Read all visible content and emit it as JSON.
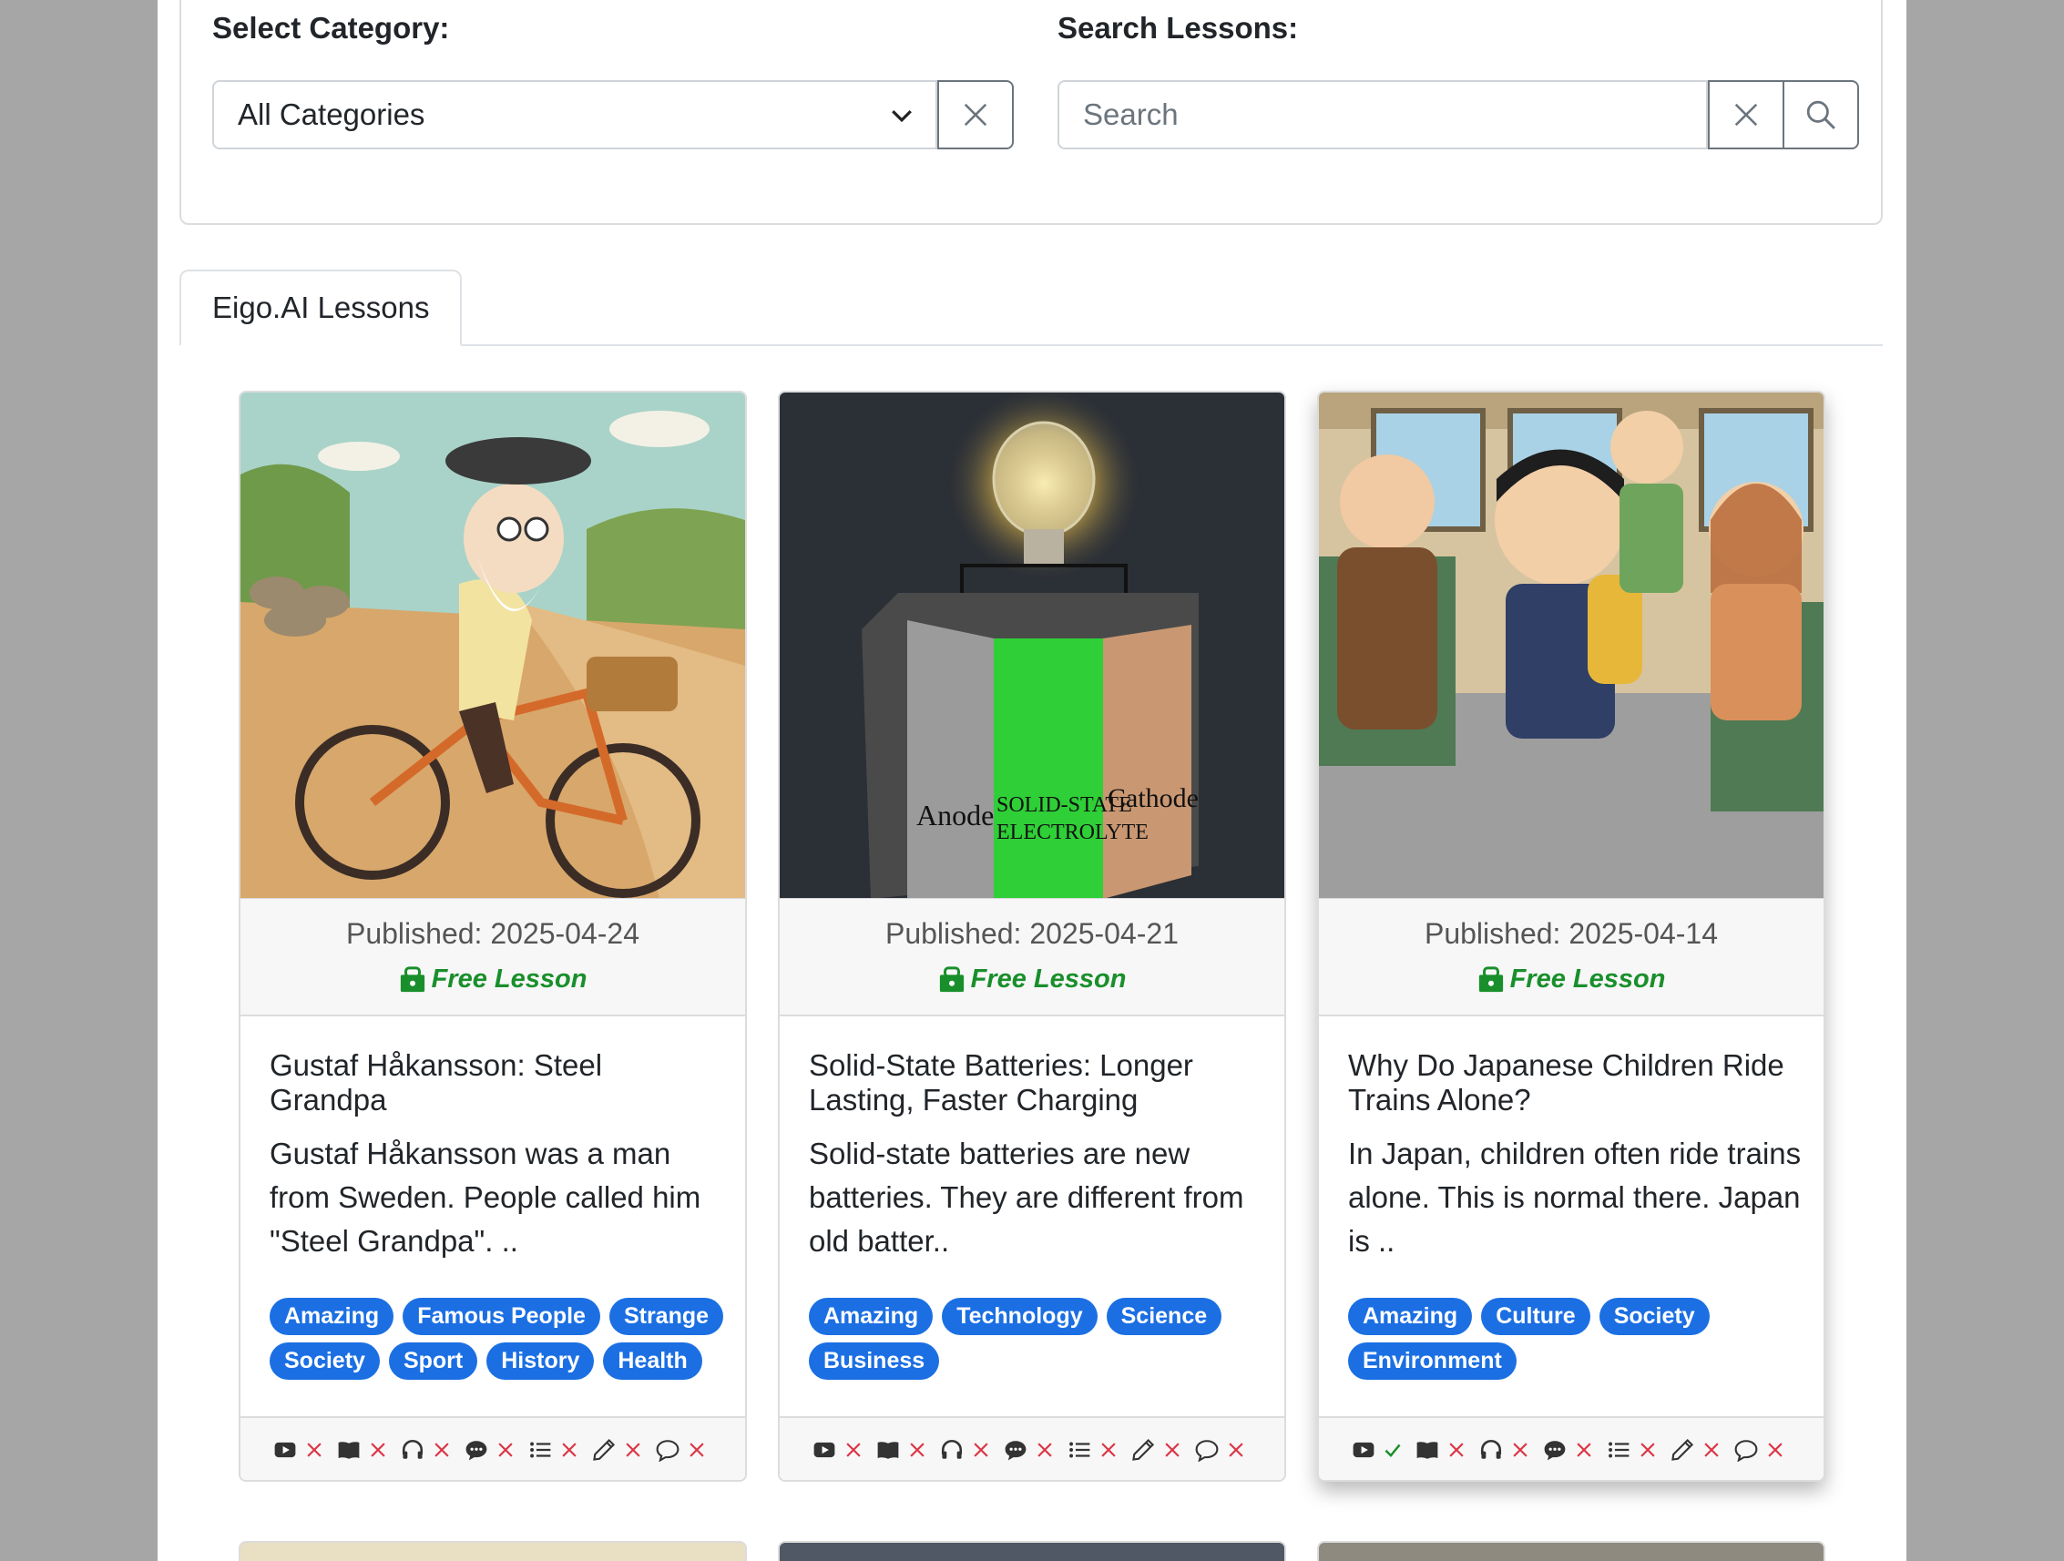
{
  "filters": {
    "category_label": "Select Category:",
    "category_value": "All Categories",
    "search_label": "Search Lessons:",
    "search_placeholder": "Search"
  },
  "tabs": [
    {
      "label": "Eigo.AI Lessons"
    }
  ],
  "colors": {
    "accent_tag": "#1b6fe3",
    "free_green": "#198f2b",
    "cross_red": "#dc3545",
    "check_green": "#198f2b"
  },
  "lessons": [
    {
      "published": "Published: 2025-04-24",
      "badge": "Free Lesson",
      "title": "Gustaf Håkansson: Steel Grandpa",
      "description": "Gustaf Håkansson was a man from Sweden. People called him \"Steel Grandpa\". ..",
      "tags": [
        "Amazing",
        "Famous People",
        "Strange",
        "Society",
        "Sport",
        "History",
        "Health"
      ],
      "features": {
        "video": "cross",
        "reading": "cross",
        "listening": "cross",
        "discussion": "cross",
        "quiz": "cross",
        "writing": "cross",
        "chat": "cross"
      }
    },
    {
      "published": "Published: 2025-04-21",
      "badge": "Free Lesson",
      "title": "Solid-State Batteries: Longer Lasting, Faster Charging",
      "description": "Solid-state batteries are new batteries. They are different from old batter..",
      "tags": [
        "Amazing",
        "Technology",
        "Science",
        "Business"
      ],
      "image_labels": {
        "anode": "Anode",
        "electrolyte_1": "SOLID-STATE",
        "electrolyte_2": "ELECTROLYTE",
        "cathode": "Cathode"
      },
      "features": {
        "video": "cross",
        "reading": "cross",
        "listening": "cross",
        "discussion": "cross",
        "quiz": "cross",
        "writing": "cross",
        "chat": "cross"
      }
    },
    {
      "published": "Published: 2025-04-14",
      "badge": "Free Lesson",
      "title": "Why Do Japanese Children Ride Trains Alone?",
      "description": "In Japan, children often ride trains alone. This is normal there. Japan is ..",
      "tags": [
        "Amazing",
        "Culture",
        "Society",
        "Environment"
      ],
      "features": {
        "video": "check",
        "reading": "cross",
        "listening": "cross",
        "discussion": "cross",
        "quiz": "cross",
        "writing": "cross",
        "chat": "cross"
      }
    }
  ]
}
